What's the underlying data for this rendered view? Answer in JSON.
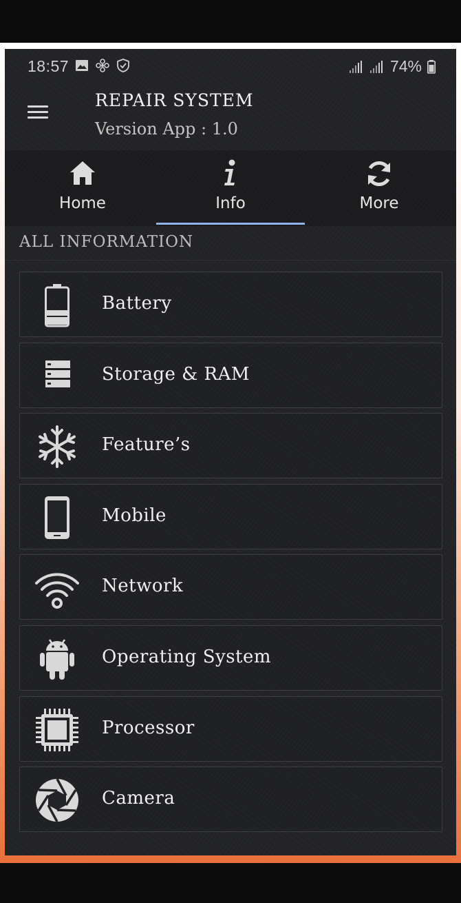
{
  "status_bar": {
    "time": "18:57",
    "battery": "74%",
    "icons": [
      "image-icon",
      "fan-icon",
      "shield-icon",
      "signal-icon",
      "signal-icon",
      "battery-icon"
    ]
  },
  "header": {
    "title": "REPAIR SYSTEM",
    "version": "Version App : 1.0",
    "menu_icon": "hamburger-menu-icon"
  },
  "tabs": [
    {
      "label": "Home",
      "icon": "home-icon",
      "selected": false
    },
    {
      "label": "Info",
      "icon": "info-icon",
      "selected": true
    },
    {
      "label": "More",
      "icon": "refresh-icon",
      "selected": false
    }
  ],
  "section": {
    "title": "ALL INFORMATION"
  },
  "items": [
    {
      "label": "Battery",
      "icon": "battery-icon"
    },
    {
      "label": "Storage & RAM",
      "icon": "storage-icon"
    },
    {
      "label": "Feature’s",
      "icon": "snowflake-icon"
    },
    {
      "label": "Mobile",
      "icon": "smartphone-icon"
    },
    {
      "label": "Network",
      "icon": "wifi-icon"
    },
    {
      "label": "Operating System",
      "icon": "android-icon"
    },
    {
      "label": "Processor",
      "icon": "processor-chip-icon"
    },
    {
      "label": "Camera",
      "icon": "camera-aperture-icon"
    }
  ],
  "colors": {
    "background": "#232427",
    "tab_indicator": "#8fb4ea",
    "frame_accent": "#e8713d",
    "icon": "#d9d9d9"
  }
}
